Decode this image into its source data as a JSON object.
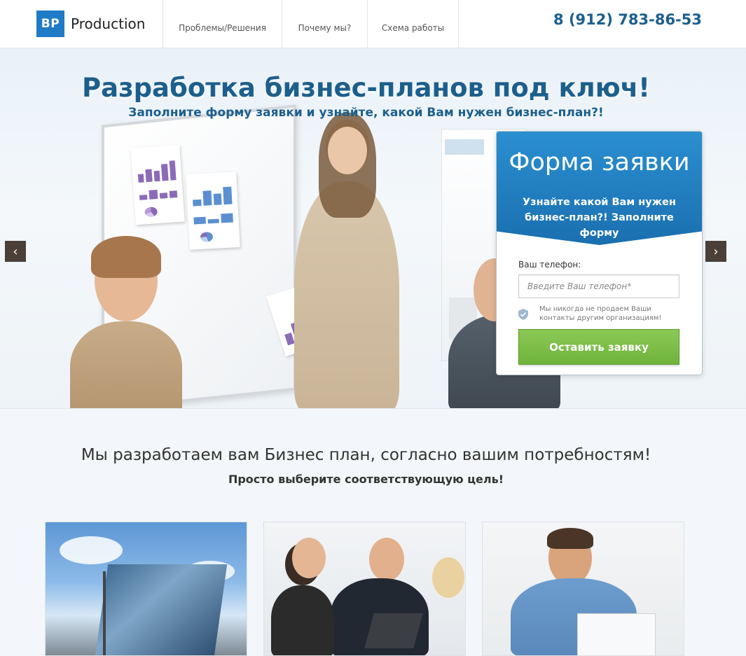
{
  "header": {
    "logo_mark": "BP",
    "logo_text": "Production",
    "nav": [
      "Проблемы/Решения",
      "Почему мы?",
      "Схема работы"
    ],
    "phone": "8 (912) 783-86-53"
  },
  "hero": {
    "title": "Разработка бизнес-планов под ключ!",
    "subtitle": "Заполните форму заявки и узнайте, какой Вам нужен бизнес-план?!",
    "prev_arrow": "‹",
    "next_arrow": "›"
  },
  "form": {
    "title": "Форма заявки",
    "subtitle": "Узнайте какой Вам нужен бизнес-план?! Заполните форму",
    "phone_label": "Ваш телефон:",
    "phone_placeholder": "Введите Ваш телефон*",
    "privacy_note": "Мы никогда не продаем Ваши контакты другим организациям!",
    "submit_label": "Оставить заявку"
  },
  "goals": {
    "title": "Мы разработаем вам Бизнес план, согласно вашим потребностям!",
    "subtitle": "Просто выберите соответствующую цель!",
    "cards": [
      {
        "image": "office-building"
      },
      {
        "image": "business-meeting"
      },
      {
        "image": "man-with-laptop"
      }
    ]
  },
  "colors": {
    "brand_blue": "#1f7bc6",
    "title_blue": "#1d5f8c",
    "button_green": "#7cbf48"
  }
}
